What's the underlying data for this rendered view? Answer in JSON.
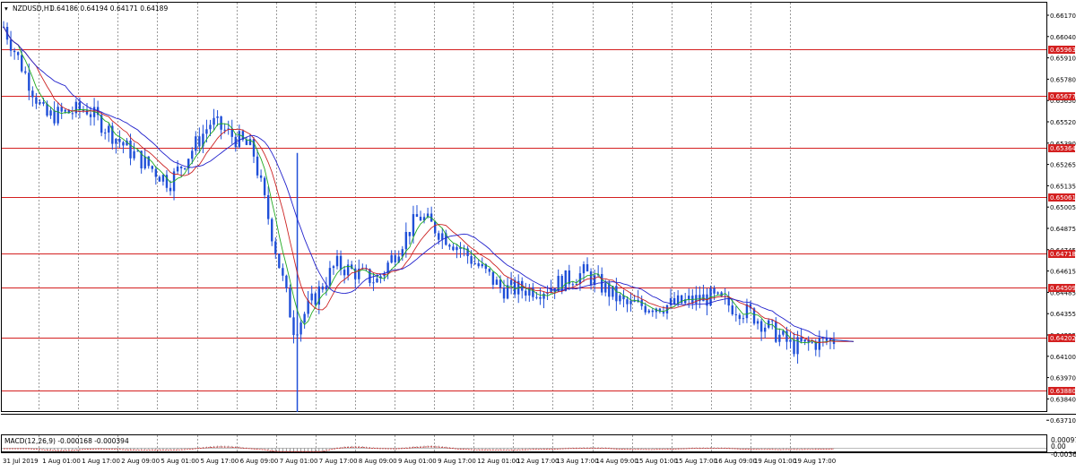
{
  "window": {
    "symbol_label": "NZDUSD,H1",
    "ohlc_label": "0.64186 0.64194 0.64171 0.64189"
  },
  "main_price_axis": {
    "ticks": [
      "0.66170",
      "0.66040",
      "0.65910",
      "0.65780",
      "0.65650",
      "0.65520",
      "0.65390",
      "0.65265",
      "0.65135",
      "0.65005",
      "0.64875",
      "0.64745",
      "0.64615",
      "0.64485",
      "0.64355",
      "0.64225",
      "0.64100",
      "0.63970",
      "0.63840",
      "0.63710"
    ]
  },
  "horizontal_levels": [
    {
      "value": 0.65963,
      "label": "0.65963"
    },
    {
      "value": 0.65677,
      "label": "0.65677"
    },
    {
      "value": 0.65364,
      "label": "0.65364"
    },
    {
      "value": 0.65061,
      "label": "0.65061"
    },
    {
      "value": 0.64718,
      "label": "0.64718"
    },
    {
      "value": 0.64509,
      "label": "0.64509"
    },
    {
      "value": 0.64202,
      "label": "0.64202"
    },
    {
      "value": 0.6388,
      "label": "0.63880"
    }
  ],
  "time_axis": {
    "labels": [
      "31 Jul 2019",
      "1 Aug 01:00",
      "1 Aug 17:00",
      "2 Aug 09:00",
      "5 Aug 01:00",
      "5 Aug 17:00",
      "6 Aug 09:00",
      "7 Aug 01:00",
      "7 Aug 17:00",
      "8 Aug 09:00",
      "9 Aug 01:00",
      "9 Aug 17:00",
      "12 Aug 01:00",
      "12 Aug 17:00",
      "13 Aug 17:00",
      "14 Aug 09:00",
      "15 Aug 01:00",
      "15 Aug 17:00",
      "16 Aug 09:00",
      "19 Aug 01:00",
      "19 Aug 17:00"
    ]
  },
  "macd": {
    "label": "MACD(12,26,9) -0.000168 -0.000394",
    "axis_ticks": [
      "0.000978",
      "0.00",
      "-0.003603"
    ]
  },
  "colors": {
    "candles": "#1f4fd8",
    "level_line": "#d42020",
    "ma_fast": "#22aa22",
    "ma_mid": "#cc2222",
    "ma_slow": "#2222cc",
    "grid": "#9a9a9a"
  },
  "chart_data": {
    "type": "line",
    "title": "NZDUSD,H1",
    "price_path": {
      "x": [
        "31 Jul 2019",
        "1 Aug 01:00",
        "1 Aug 17:00",
        "2 Aug 09:00",
        "5 Aug 01:00",
        "5 Aug 17:00",
        "6 Aug 09:00",
        "7 Aug 01:00",
        "7 Aug 17:00",
        "8 Aug 09:00",
        "9 Aug 01:00",
        "9 Aug 17:00",
        "12 Aug 01:00",
        "12 Aug 17:00",
        "13 Aug 17:00",
        "14 Aug 09:00",
        "15 Aug 01:00",
        "15 Aug 17:00",
        "16 Aug 09:00",
        "19 Aug 01:00",
        "19 Aug 17:00"
      ],
      "y": [
        0.661,
        0.6555,
        0.656,
        0.6535,
        0.6515,
        0.6552,
        0.6535,
        0.6425,
        0.6465,
        0.6455,
        0.6495,
        0.6475,
        0.645,
        0.645,
        0.646,
        0.644,
        0.644,
        0.6445,
        0.6435,
        0.6415,
        0.6419
      ]
    },
    "last_ohlc": {
      "open": 0.64186,
      "high": 0.64194,
      "low": 0.64171,
      "close": 0.64189
    },
    "ylim": [
      0.6371,
      0.6617
    ],
    "grid": true
  }
}
